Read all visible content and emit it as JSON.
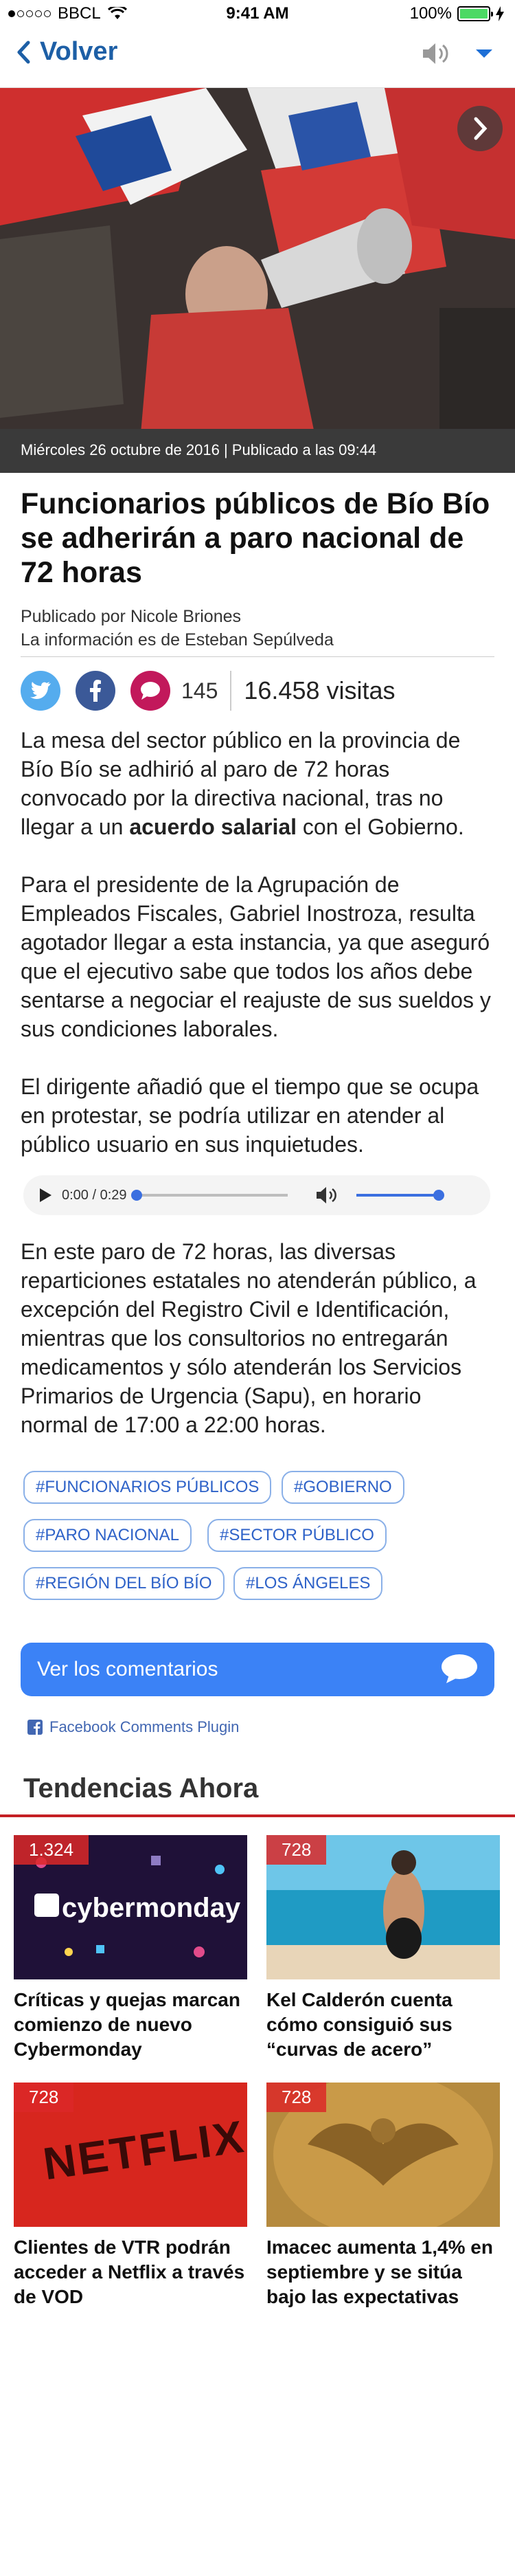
{
  "status_bar": {
    "carrier": "BBCL",
    "time": "9:41 AM",
    "battery": "100%"
  },
  "nav": {
    "back_label": "Volver"
  },
  "hero": {
    "caption": "Miércoles 26 octubre de 2016 | Publicado a las 09:44"
  },
  "article": {
    "title": "Funcionarios públicos de Bío Bío se adherirán a paro nacional de 72 horas",
    "published_by": "Publicado por Nicole Briones",
    "info_by": "La información es de Esteban Sepúlveda",
    "comments_count": "145",
    "visits": "16.458 visitas",
    "p1_before": "La mesa del sector público en la provincia de Bío Bío se adhirió al paro de 72 horas convocado por la directiva nacional, tras no llegar a un ",
    "p1_bold": "acuerdo salarial",
    "p1_after": " con el Gobierno.",
    "p2": "Para el presidente de la Agrupación de Empleados Fiscales, Gabriel Inostroza, resulta agotador llegar a esta instancia, ya que aseguró que el ejecutivo sabe que todos los años debe sentarse a negociar el reajuste de sus sueldos y sus condiciones laborales.",
    "p3": "El dirigente añadió que el tiempo que se ocupa en protestar, se podría utilizar en atender al público usuario en sus inquietudes.",
    "p4": "En este paro de 72 horas, las diversas reparticiones estatales no atenderán público, a excepción del Registro Civil e Identificación, mientras que los consultorios no entregarán medicamentos y sólo atenderán los Servicios Primarios de Urgencia (Sapu), en horario normal de 17:00 a 22:00 horas."
  },
  "audio": {
    "time": "0:00 / 0:29",
    "progress": 0,
    "volume": 1
  },
  "tags": [
    "#FUNCIONARIOS PÚBLICOS",
    "#GOBIERNO",
    "#PARO NACIONAL",
    "#SECTOR PÚBLICO",
    "#REGIÓN DEL BÍO BÍO",
    "#LOS ÁNGELES"
  ],
  "comments": {
    "button_label": "Ver los comentarios",
    "plugin_label": "Facebook Comments Plugin"
  },
  "trending": {
    "title": "Tendencias Ahora",
    "items": [
      {
        "count": "1.324",
        "title": "Críticas y quejas marcan comienzo de nuevo Cybermonday",
        "image_text": "cybermonday"
      },
      {
        "count": "728",
        "title": "Kel Calderón cuenta cómo consiguió sus “curvas de acero”"
      },
      {
        "count": "728",
        "title": "Clientes de VTR podrán acceder a Netflix a través de VOD",
        "image_text": "NETFLIX"
      },
      {
        "count": "728",
        "title": "Imacec aumenta 1,4% en septiembre y se sitúa bajo las expectativas"
      }
    ]
  },
  "colors": {
    "link_blue": "#1d5fa6",
    "accent_red": "#c41f24",
    "button_blue": "#3b82f6",
    "twitter": "#55acee",
    "facebook": "#3b5998",
    "comment_pink": "#c2185b"
  }
}
